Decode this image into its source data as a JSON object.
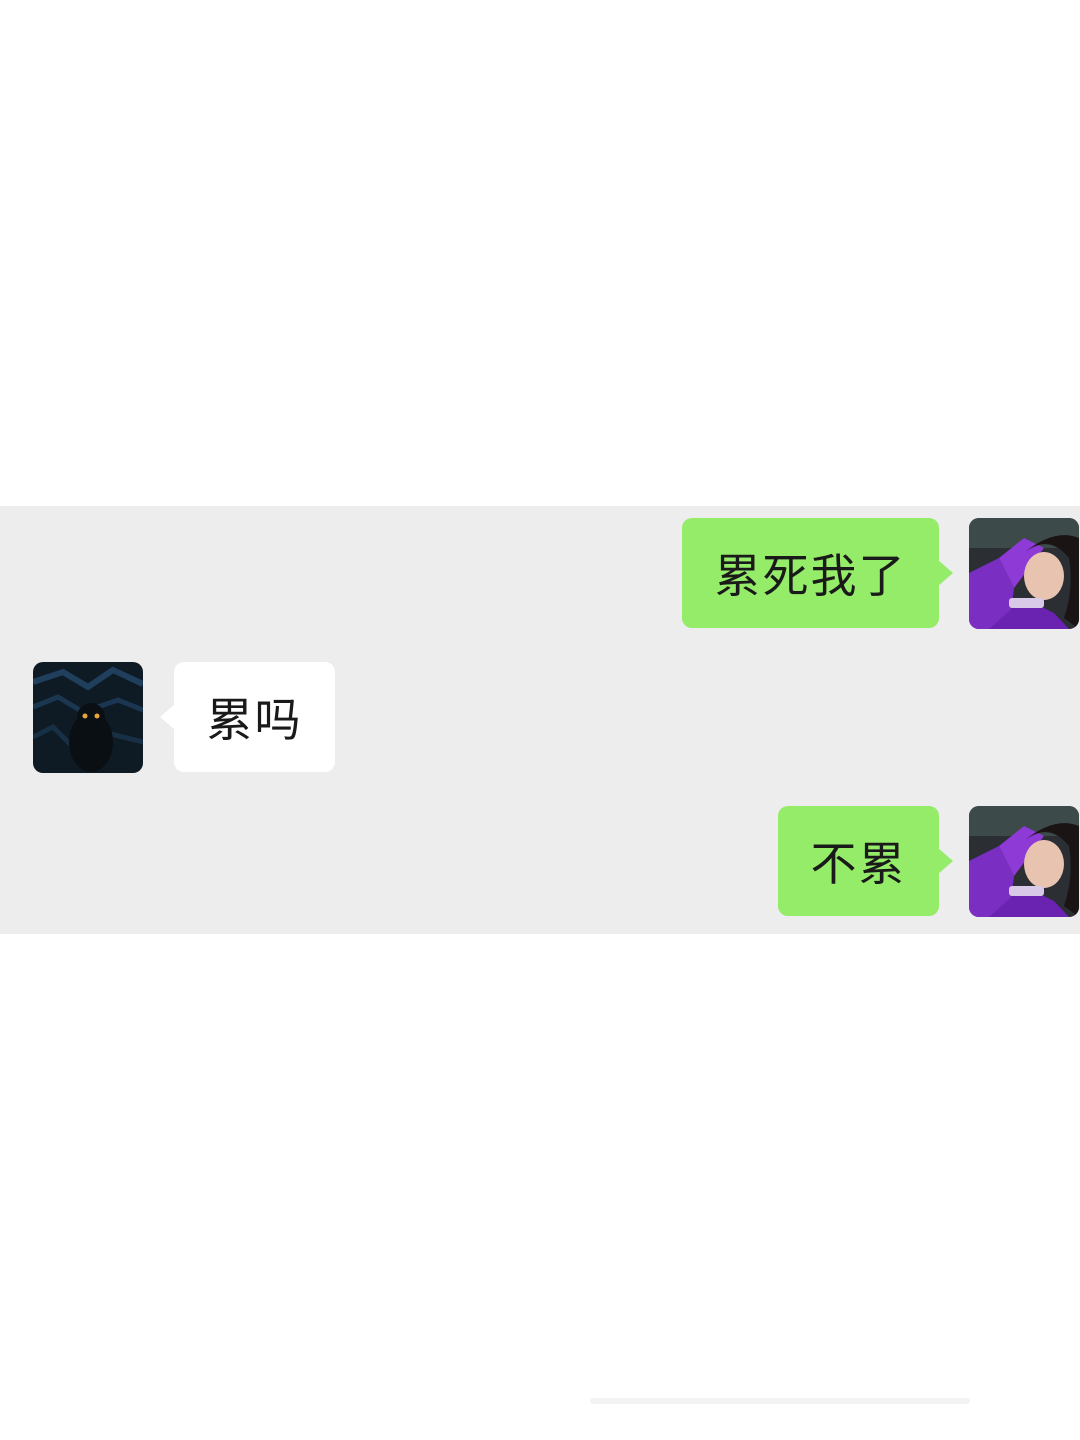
{
  "chat": {
    "messages": [
      {
        "sender": "self",
        "text": "累死我了"
      },
      {
        "sender": "other",
        "text": "累吗"
      },
      {
        "sender": "self",
        "text": "不累"
      }
    ]
  },
  "avatars": {
    "self": "user-avatar-purple-portrait",
    "other": "contact-avatar-dark-cat"
  },
  "colors": {
    "chat_background": "#ededed",
    "sent_bubble": "#95ec69",
    "received_bubble": "#ffffff",
    "page_background": "#ffffff"
  }
}
